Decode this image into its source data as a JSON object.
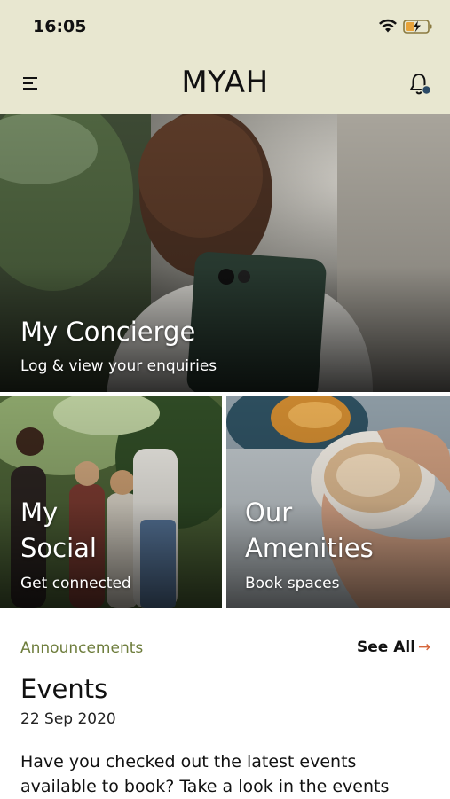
{
  "status_bar": {
    "time": "16:05",
    "icons": [
      "wifi-icon",
      "battery-charging-icon"
    ]
  },
  "header": {
    "title": "MYAH",
    "menu_icon": "hamburger-menu-icon",
    "notification_icon": "bell-icon",
    "notification_dot_color": "#2b4a66"
  },
  "tiles": {
    "concierge": {
      "title": "My Concierge",
      "subtitle": "Log & view your enquiries"
    },
    "social": {
      "title_line1": "My",
      "title_line2": "Social",
      "subtitle": "Get connected"
    },
    "amenities": {
      "title_line1": "Our",
      "title_line2": "Amenities",
      "subtitle": "Book spaces"
    }
  },
  "announcements": {
    "section_label": "Announcements",
    "see_all_label": "See All",
    "see_all_arrow": "→",
    "event": {
      "title": "Events",
      "date": "22 Sep 2020",
      "body_line1": "Have you checked out the latest events",
      "body_line2": "available to book? Take a look in the events"
    }
  },
  "colors": {
    "header_bg": "#e8e7d0",
    "accent_green": "#6e7d3c",
    "arrow_orange": "#d6663b"
  }
}
